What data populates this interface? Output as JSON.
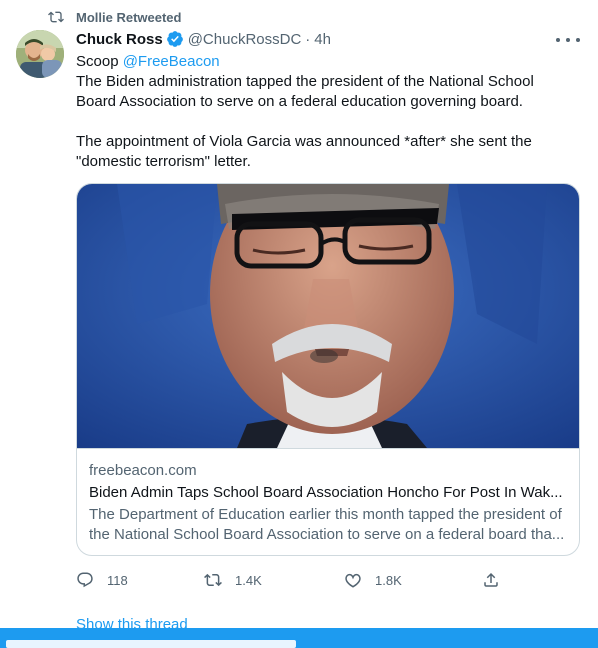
{
  "retweet": {
    "label": "Mollie Retweeted"
  },
  "author": {
    "name": "Chuck Ross",
    "handle": "@ChuckRossDC",
    "separator": "·",
    "time": "4h"
  },
  "tweet": {
    "scoop": "Scoop ",
    "mention": "@FreeBeacon",
    "body": "The Biden administration tapped the president of the National School Board Association to serve on a federal education governing board.\n\nThe appointment of Viola Garcia was announced *after* she sent the \"domestic terrorism\" letter."
  },
  "card": {
    "domain": "freebeacon.com",
    "title": "Biden Admin Taps School Board Association Honcho For Post In Wak...",
    "description": "The Department of Education earlier this month tapped the president of the National School Board Association to serve on a federal board tha..."
  },
  "actions": {
    "replies": "118",
    "retweets": "1.4K",
    "likes": "1.8K"
  },
  "thread": {
    "label": "Show this thread"
  },
  "colors": {
    "accent": "#1d9bf0",
    "secondary_text": "#536471",
    "border": "#cfd9de"
  },
  "icons": [
    "retweet-icon",
    "verified-badge-icon",
    "more-icon",
    "reply-icon",
    "retweet-icon",
    "like-icon",
    "share-icon"
  ]
}
